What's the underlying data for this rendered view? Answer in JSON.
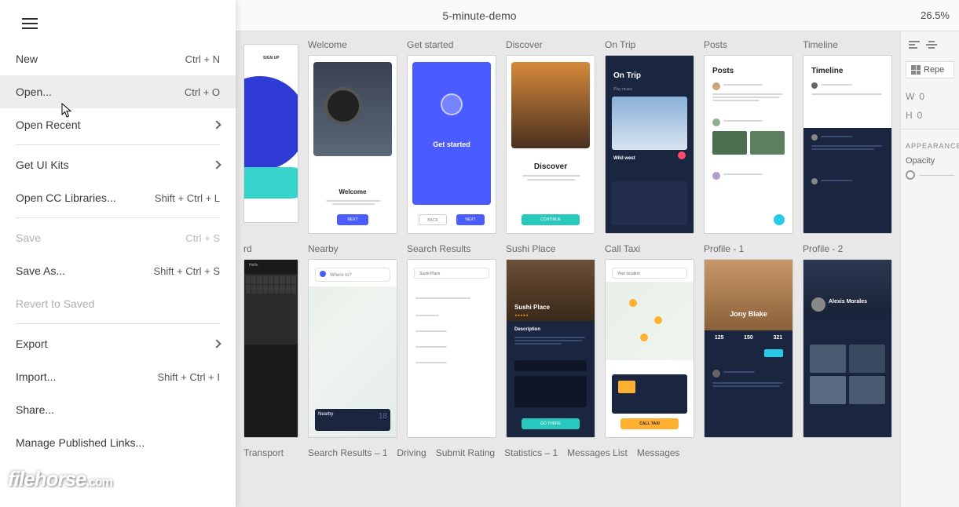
{
  "header": {
    "doc_title": "5-minute-demo",
    "zoom": "26.5%"
  },
  "menu": {
    "items": [
      {
        "label": "New",
        "shortcut": "Ctrl + N",
        "type": "item"
      },
      {
        "label": "Open...",
        "shortcut": "Ctrl + O",
        "type": "item",
        "hover": true
      },
      {
        "label": "Open Recent",
        "type": "submenu"
      },
      {
        "type": "sep"
      },
      {
        "label": "Get UI Kits",
        "type": "submenu"
      },
      {
        "label": "Open CC Libraries...",
        "shortcut": "Shift + Ctrl + L",
        "type": "item"
      },
      {
        "type": "sep"
      },
      {
        "label": "Save",
        "shortcut": "Ctrl + S",
        "type": "item",
        "disabled": true
      },
      {
        "label": "Save As...",
        "shortcut": "Shift + Ctrl + S",
        "type": "item"
      },
      {
        "label": "Revert to Saved",
        "type": "item",
        "disabled": true
      },
      {
        "type": "sep"
      },
      {
        "label": "Export",
        "type": "submenu"
      },
      {
        "label": "Import...",
        "shortcut": "Shift + Ctrl + I",
        "type": "item"
      },
      {
        "label": "Share...",
        "type": "item"
      },
      {
        "label": "Manage Published Links...",
        "type": "item"
      }
    ]
  },
  "artboards": {
    "row1": [
      {
        "title": ""
      },
      {
        "title": "Welcome"
      },
      {
        "title": "Get started"
      },
      {
        "title": "Discover"
      },
      {
        "title": "On Trip"
      },
      {
        "title": "Posts"
      },
      {
        "title": "Timeline"
      }
    ],
    "row2": [
      {
        "title": "rd"
      },
      {
        "title": "Nearby"
      },
      {
        "title": "Search Results"
      },
      {
        "title": "Sushi Place"
      },
      {
        "title": "Call Taxi"
      },
      {
        "title": "Profile - 1"
      },
      {
        "title": "Profile - 2"
      }
    ],
    "row3": [
      {
        "title": "Transport"
      },
      {
        "title": "Search Results – 1"
      },
      {
        "title": "Driving"
      },
      {
        "title": "Submit Rating"
      },
      {
        "title": "Statistics – 1"
      },
      {
        "title": "Messages List"
      },
      {
        "title": "Messages"
      }
    ]
  },
  "mocks": {
    "signup": "SIGN UP",
    "welcome": "Welcome",
    "next": "NEXT",
    "back": "BACK",
    "getstarted": "Get started",
    "discover": "Discover",
    "continue": "CONTINUE",
    "ontrip": "On Trip",
    "playmusic": "Play music",
    "wildwest": "Wild west",
    "posts": "Posts",
    "timeline": "Timeline",
    "hello": "Hello",
    "whereto": "Where to?",
    "sushiplace": "Sushi Place",
    "description": "Description",
    "gothere": "GO THERE",
    "yourlocation": "Your location",
    "calltaxi": "CALL TAXI",
    "jony": "Jony Blake",
    "alexis": "Alexis Morales",
    "stats": {
      "a": "125",
      "b": "150",
      "c": "321"
    }
  },
  "inspector": {
    "repeat": "Repe",
    "w_label": "W",
    "w_val": "0",
    "h_label": "H",
    "h_val": "0",
    "appearance": "APPEARANCE",
    "opacity": "Opacity"
  },
  "watermark": {
    "name": "filehorse",
    "tld": ".com"
  }
}
